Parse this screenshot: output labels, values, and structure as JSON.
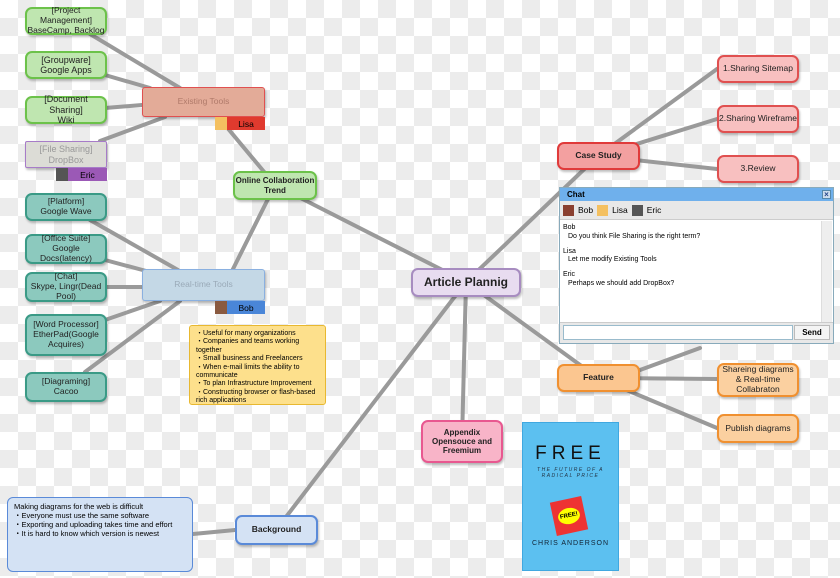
{
  "central": "Article Plannig",
  "existing_tools": {
    "label": "Existing Tools",
    "owner": "Lisa",
    "children": [
      "[Project Management]\nBaseCamp, Backlog",
      "[Groupware]\nGoogle Apps",
      "[Document Sharing]\nWiki",
      "[File Sharing]\nDropBox"
    ],
    "file_sharing_owner": "Eric"
  },
  "online_collab": "Online Collaboration\nTrend",
  "realtime_tools": {
    "label": "Real-time Tools",
    "owner": "Bob",
    "children": [
      "[Platform]\nGoogle Wave",
      "[Office Suite]\nGoogle\nDocs(latency)",
      "[Chat]\nSkype, Lingr(Dead\nPool)",
      "[Word Processor]\nEtherPad(Google\nAcquires)",
      "[Diagraming]\nCacoo"
    ]
  },
  "realtime_note": "・Useful for many organizations\n・Companies and teams working\ntogether\n・Small business and Freelancers\n・When e-mail limits the ability to\ncommunicate\n・To plan Infrastructure Improvement\n・Constructing browser or flash-based\nrich applications",
  "case_study": {
    "label": "Case Study",
    "children": [
      "1.Sharing Sitemap",
      "2.Sharing Wireframe",
      "3.Review"
    ]
  },
  "feature": {
    "label": "Feature",
    "children": [
      "Shareing diagrams\n& Real-time\nCollabraton",
      "Publish diagrams"
    ]
  },
  "appendix": "Appendix\nOpensouce and\nFreemium",
  "background": {
    "label": "Background",
    "note": "Making diagrams for the web is difficult\n・Everyone must use the same software\n・Exporting and uploading takes time and effort\n・It is hard to know which version is newest"
  },
  "book": {
    "title": "FREE",
    "subtitle": "THE FUTURE OF A RADICAL PRICE",
    "tag": "FREE!",
    "author": "CHRIS ANDERSON"
  },
  "chat": {
    "title": "Chat",
    "close": "×",
    "users": [
      "Bob",
      "Lisa",
      "Eric"
    ],
    "messages": [
      {
        "user": "Bob",
        "text": "Do you think File Sharing is the right term?"
      },
      {
        "user": "Lisa",
        "text": "Let me modify Existing Tools"
      },
      {
        "user": "Eric",
        "text": "Perhaps we should add DropBox?"
      }
    ],
    "input_value": "",
    "send": "Send"
  },
  "colors": {
    "lisa": "#e03a2e",
    "eric": "#9b59b6",
    "bob": "#4a86d8",
    "line": "#999999"
  }
}
